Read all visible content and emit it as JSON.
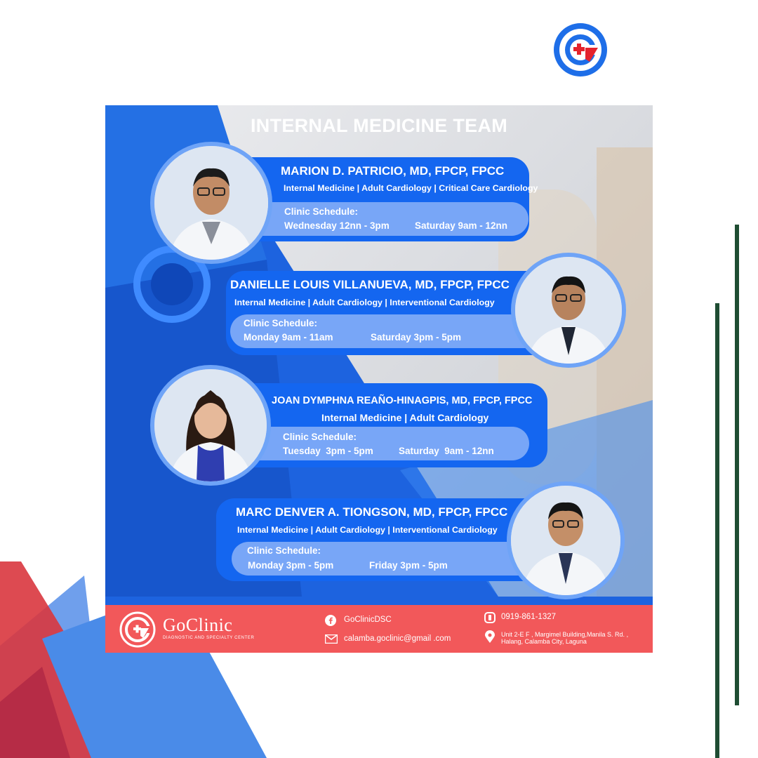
{
  "poster": {
    "title": "INTERNAL MEDICINE TEAM",
    "doctors": [
      {
        "name": "MARION D. PATRICIO, MD, FPCP, FPCC",
        "specialties": "Internal Medicine | Adult Cardiology | Critical Care Cardiology",
        "schedule_label": "Clinic Schedule:",
        "schedule": [
          "Wednesday 12nn - 3pm",
          "Saturday 9am - 12nn"
        ]
      },
      {
        "name": "DANIELLE LOUIS VILLANUEVA, MD, FPCP, FPCC",
        "specialties": "Internal Medicine | Adult Cardiology | Interventional Cardiology",
        "schedule_label": "Clinic Schedule:",
        "schedule": [
          "Monday 9am - 11am",
          "Saturday 3pm - 5pm"
        ]
      },
      {
        "name": "JOAN DYMPHNA REAÑO-HINAGPIS, MD, FPCP, FPCC",
        "specialties": "Internal Medicine | Adult Cardiology",
        "schedule_label": "Clinic Schedule:",
        "schedule": [
          "Tuesday  3pm - 5pm",
          "Saturday  9am - 12nn"
        ]
      },
      {
        "name": "MARC DENVER A. TIONGSON, MD, FPCP, FPCC",
        "specialties": "Internal Medicine | Adult Cardiology | Interventional Cardiology",
        "schedule_label": "Clinic Schedule:",
        "schedule": [
          "Monday 3pm - 5pm",
          "Friday 3pm - 5pm"
        ]
      }
    ]
  },
  "footer": {
    "brand": "GoClinic",
    "brand_sub": "DIAGNOSTIC AND SPECIALTY CENTER",
    "facebook": "GoClinicDSC",
    "email": "calamba.goclinic@gmail .com",
    "phone": "0919-861-1327",
    "address": "Unit 2-E F , Margimel Building,Manila S. Rd. , Halang, Calamba City, Laguna"
  },
  "colors": {
    "brand_blue": "#1466f0",
    "schedule_blue": "#78a6f7",
    "footer_red": "#f2585a",
    "accent_green": "#1f4d33"
  },
  "icons": [
    "goclinic-logo",
    "facebook-icon",
    "email-icon",
    "phone-icon",
    "location-pin-icon"
  ]
}
